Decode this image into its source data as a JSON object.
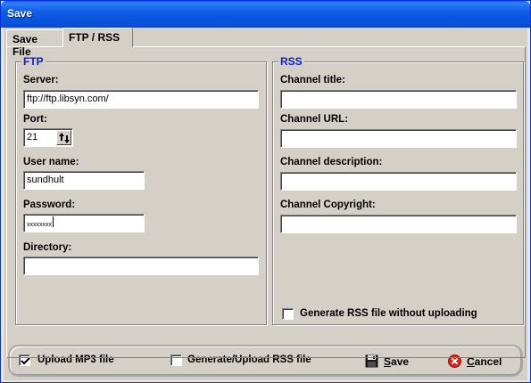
{
  "window": {
    "title": "Save"
  },
  "tabs": [
    {
      "label": "Save File"
    },
    {
      "label": "FTP / RSS"
    }
  ],
  "ftp": {
    "legend": "FTP",
    "server_label": "Server:",
    "server_value": "ftp://ftp.libsyn.com/",
    "port_label": "Port:",
    "port_value": "21",
    "username_label": "User name:",
    "username_value": "sundhult",
    "password_label": "Password:",
    "password_value": "xxxxxxxx",
    "directory_label": "Directory:",
    "directory_value": ""
  },
  "rss": {
    "legend": "RSS",
    "channel_title_label": "Channel title:",
    "channel_title_value": "",
    "channel_url_label": "Channel URL:",
    "channel_url_value": "",
    "channel_description_label": "Channel description:",
    "channel_description_value": "",
    "channel_copyright_label": "Channel Copyright:",
    "channel_copyright_value": "",
    "generate_rss_label": "Generate RSS file without uploading",
    "generate_rss_checked": false
  },
  "bottom": {
    "upload_mp3_label": "Upload MP3 file",
    "upload_mp3_checked": true,
    "generate_upload_rss_label": "Generate/Upload RSS file",
    "generate_upload_rss_checked": false,
    "save_first": "S",
    "save_rest": "ave",
    "cancel_first": "C",
    "cancel_rest": "ancel",
    "save_icon": "floppy-disk-icon",
    "cancel_icon": "red-x-icon"
  },
  "colors": {
    "titlebar": "#0a5ce8",
    "legend": "#0a24cf",
    "dialog_face": "#d4d0c8"
  }
}
